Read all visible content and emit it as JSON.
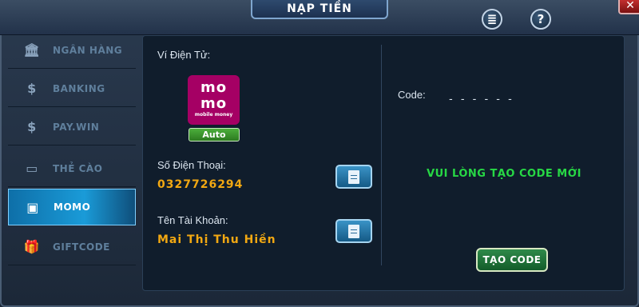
{
  "title": "NẠP TIỀN",
  "close_symbol": "✕",
  "top_icons": [
    {
      "name": "history-icon",
      "glyph": "≣"
    },
    {
      "name": "help-icon",
      "glyph": "?"
    }
  ],
  "sidebar": {
    "items": [
      {
        "label": "NGÂN HÀNG",
        "icon": "bank-icon",
        "glyph": "🏛"
      },
      {
        "label": "BANKING",
        "icon": "piggy-bank-icon",
        "glyph": "$"
      },
      {
        "label": "PAY.WIN",
        "icon": "phone-payment-icon",
        "glyph": "$"
      },
      {
        "label": "THẺ CÀO",
        "icon": "card-icon",
        "glyph": "▭"
      },
      {
        "label": "MOMO",
        "icon": "wallet-icon",
        "glyph": "▣",
        "active": true
      },
      {
        "label": "GIFTCODE",
        "icon": "gift-icon",
        "glyph": "🎁"
      }
    ]
  },
  "left_panel": {
    "wallet_label": "Ví Điện Tử:",
    "momo_logo": {
      "line1": "mo",
      "line2": "mo",
      "sub": "mobile money"
    },
    "auto_badge": "Auto",
    "phone_label": "Số Điện Thoại:",
    "phone_value": "0327726294",
    "account_label": "Tên Tài Khoản:",
    "account_value": "Mai Thị Thu Hiền"
  },
  "right_panel": {
    "code_label": "Code:",
    "code_value": "- - - - - -",
    "notice": "VUI LÒNG TẠO CODE MỚI",
    "create_button": "TẠO CODE"
  },
  "colors": {
    "accent_orange": "#f2a812",
    "notice_green": "#27d845",
    "momo_brand": "#a50064",
    "active_tab": "#1a9bd8"
  }
}
